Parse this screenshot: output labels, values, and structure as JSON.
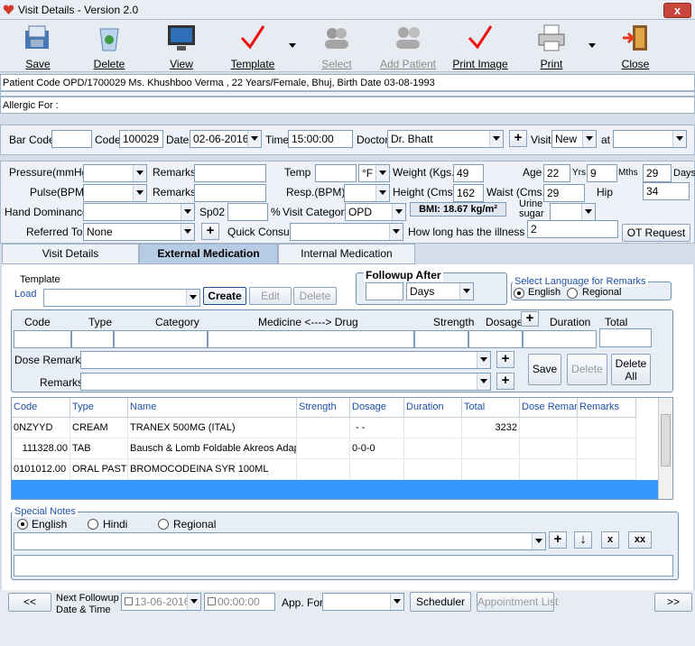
{
  "window": {
    "title": "Visit Details - Version 2.0",
    "close": "x"
  },
  "toolbar": {
    "save": "Save",
    "delete": "Delete",
    "view": "View",
    "template": "Template",
    "select": "Select",
    "add_patient": "Add Patient",
    "print_image": "Print Image",
    "print": "Print",
    "close": "Close"
  },
  "patient_info": "Patient Code OPD/1700029 Ms. Khushboo Verma , 22 Years/Female, Bhuj, Birth Date 03-08-1993",
  "allergic": "Allergic For :",
  "visit": {
    "barcode_label": "Bar Code",
    "barcode": "",
    "code_label": "Code",
    "code": "100029",
    "date_label": "Date",
    "date": "02-06-2016",
    "time_label": "Time",
    "time": "15:00:00",
    "doctor_label": "Doctor",
    "doctor": "Dr. Bhatt",
    "visit_label": "Visit",
    "visit": "New",
    "at_label": "at",
    "at": ""
  },
  "vitals": {
    "pressure_label": "Pressure(mmHg)",
    "pulse_label": "Pulse(BPM)",
    "remarks_label": "Remarks",
    "remarks2_label": "Remarks",
    "temp_label": "Temp",
    "temp_unit": "°F",
    "resp_label": "Resp.(BPM)",
    "weight_label": "Weight (Kgs.)",
    "weight": "49",
    "height_label": "Height (Cms.)",
    "height": "162",
    "waist_label": "Waist (Cms.)",
    "waist": "29",
    "age_label": "Age",
    "age_yrs": "22",
    "yrs": "Yrs",
    "age_mths": "9",
    "mths": "Mths",
    "age_days": "29",
    "days": "Days",
    "hip_label": "Hip",
    "hip": "34",
    "hand_label": "Hand Dominance",
    "spo2_label": "Sp02",
    "pct": "%",
    "visit_cat_label": "Visit Category",
    "visit_cat": "OPD",
    "bmi": "BMI: 18.67 kg/m²",
    "urine_label": "Urine sugar",
    "referred_label": "Referred To",
    "referred": "None",
    "quick_label": "Quick Consult",
    "illness_label": "How long has the illness ?",
    "illness": "2",
    "ot_request": "OT Request"
  },
  "tabs": [
    "Visit Details",
    "External Medication",
    "Internal Medication"
  ],
  "template": {
    "title": "Template",
    "load": "Load",
    "create": "Create",
    "edit": "Edit",
    "delete": "Delete"
  },
  "followup": {
    "title": "Followup After",
    "value": "",
    "unit": "Days"
  },
  "language": {
    "title": "Select Language for Remarks",
    "english": "English",
    "regional": "Regional"
  },
  "med_entry": {
    "code": "Code",
    "type": "Type",
    "category": "Category",
    "medicine": "Medicine <----> Drug",
    "strength": "Strength",
    "dosage": "Dosage",
    "duration": "Duration",
    "total": "Total",
    "dose_remarks": "Dose Remarks",
    "remarks": "Remarks",
    "save": "Save",
    "delete": "Delete",
    "delete_all": "Delete All"
  },
  "grid": {
    "headers": [
      "Code",
      "Type",
      "Name",
      "Strength",
      "Dosage",
      "Duration",
      "Total",
      "Dose Remar",
      "Remarks"
    ],
    "rows": [
      [
        "0NZYYD",
        "CREAM",
        "TRANEX 500MG (ITAL)",
        "",
        "- -",
        "",
        "3232",
        "",
        ""
      ],
      [
        "111328.00",
        "TAB",
        "Bausch & Lomb Foldable Akreos Adap",
        "",
        "0-0-0",
        "",
        "",
        "",
        ""
      ],
      [
        "0101012.00",
        "ORAL PAST",
        "BROMOCODEINA SYR 100ML",
        "",
        "",
        "",
        "",
        "",
        ""
      ]
    ]
  },
  "special_notes": {
    "title": "Special Notes",
    "english": "English",
    "hindi": "Hindi",
    "regional": "Regional"
  },
  "bottom": {
    "prev": "<<",
    "next": ">>",
    "next_followup": "Next Followup",
    "date_time": "Date & Time",
    "fdate": "13-06-2016",
    "ftime": "00:00:00",
    "app_for": "App. For",
    "scheduler": "Scheduler",
    "appointment_list": "Appointment List"
  }
}
